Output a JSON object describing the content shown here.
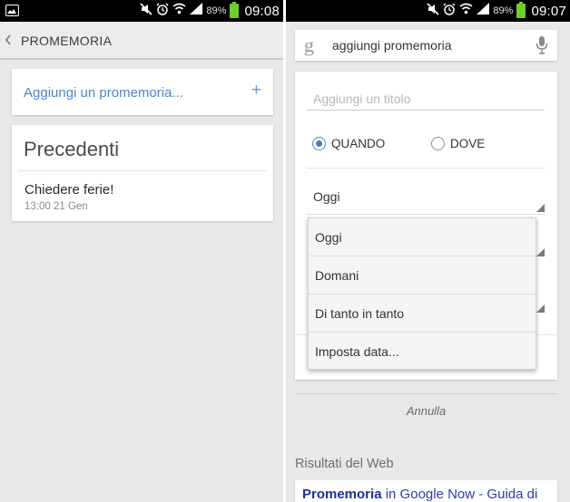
{
  "left_screen": {
    "status_bar": {
      "battery_percent": "89%",
      "time": "09:08"
    },
    "action_bar": {
      "title": "PROMEMORIA"
    },
    "add_card": {
      "label": "Aggiungi un promemoria...",
      "plus": "+"
    },
    "previous_card": {
      "title": "Precedenti",
      "items": [
        {
          "title": "Chiedere ferie!",
          "time": "13:00 21 Gen"
        }
      ]
    }
  },
  "right_screen": {
    "status_bar": {
      "battery_percent": "89%",
      "time": "09:07"
    },
    "search": {
      "logo": "g",
      "query": "aggiungi promemoria"
    },
    "form": {
      "title_placeholder": "Aggiungi un titolo",
      "radio_when": "QUANDO",
      "radio_where": "DOVE",
      "day_value": "Oggi"
    },
    "dropdown": {
      "options": [
        "Oggi",
        "Domani",
        "Di tanto in tanto",
        "Imposta data..."
      ]
    },
    "cancel_label": "Annulla",
    "web_results_label": "Risultati del Web",
    "result": {
      "bold": "Promemoria",
      "rest": " in Google Now - Guida di"
    }
  },
  "colors": {
    "accent": "#4a86c8",
    "battery": "#6fce2c",
    "link": "#2a3fad"
  }
}
